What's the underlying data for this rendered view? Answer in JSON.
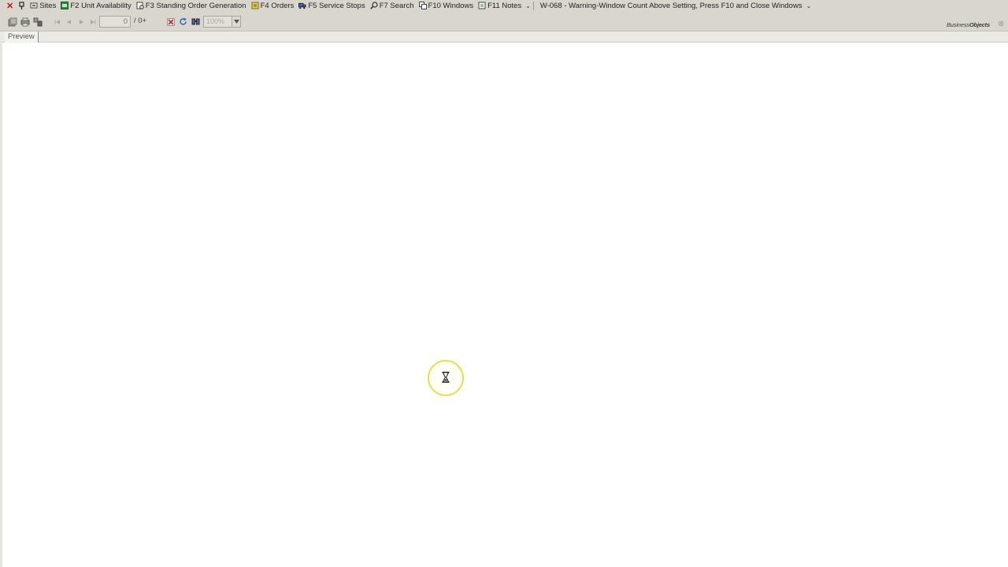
{
  "menubar": {
    "items": [
      {
        "label": "Sites",
        "icon": "sites-icon"
      },
      {
        "label": "F2 Unit Availability",
        "icon": "unit-availability-icon"
      },
      {
        "label": "F3 Standing Order Generation",
        "icon": "standing-order-icon"
      },
      {
        "label": "F4 Orders",
        "icon": "orders-icon"
      },
      {
        "label": "F5 Service Stops",
        "icon": "service-stops-icon"
      },
      {
        "label": "F7 Search",
        "icon": "search-icon"
      },
      {
        "label": "F10 Windows",
        "icon": "windows-icon"
      },
      {
        "label": "F11 Notes",
        "icon": "notes-icon"
      }
    ],
    "warning": "W-068 - Warning-Window Count Above Setting, Press F10 and Close Windows"
  },
  "toolbar": {
    "page_value": "0",
    "page_total": "/ 0+",
    "zoom_value": "100%",
    "logo_part1": "Business",
    "logo_part2": "Objects"
  },
  "tabs": [
    {
      "label": "Preview"
    }
  ],
  "colors": {
    "chrome": "#d9d6ce",
    "close_red": "#c01010",
    "cursor_ring": "#e6e04a"
  }
}
